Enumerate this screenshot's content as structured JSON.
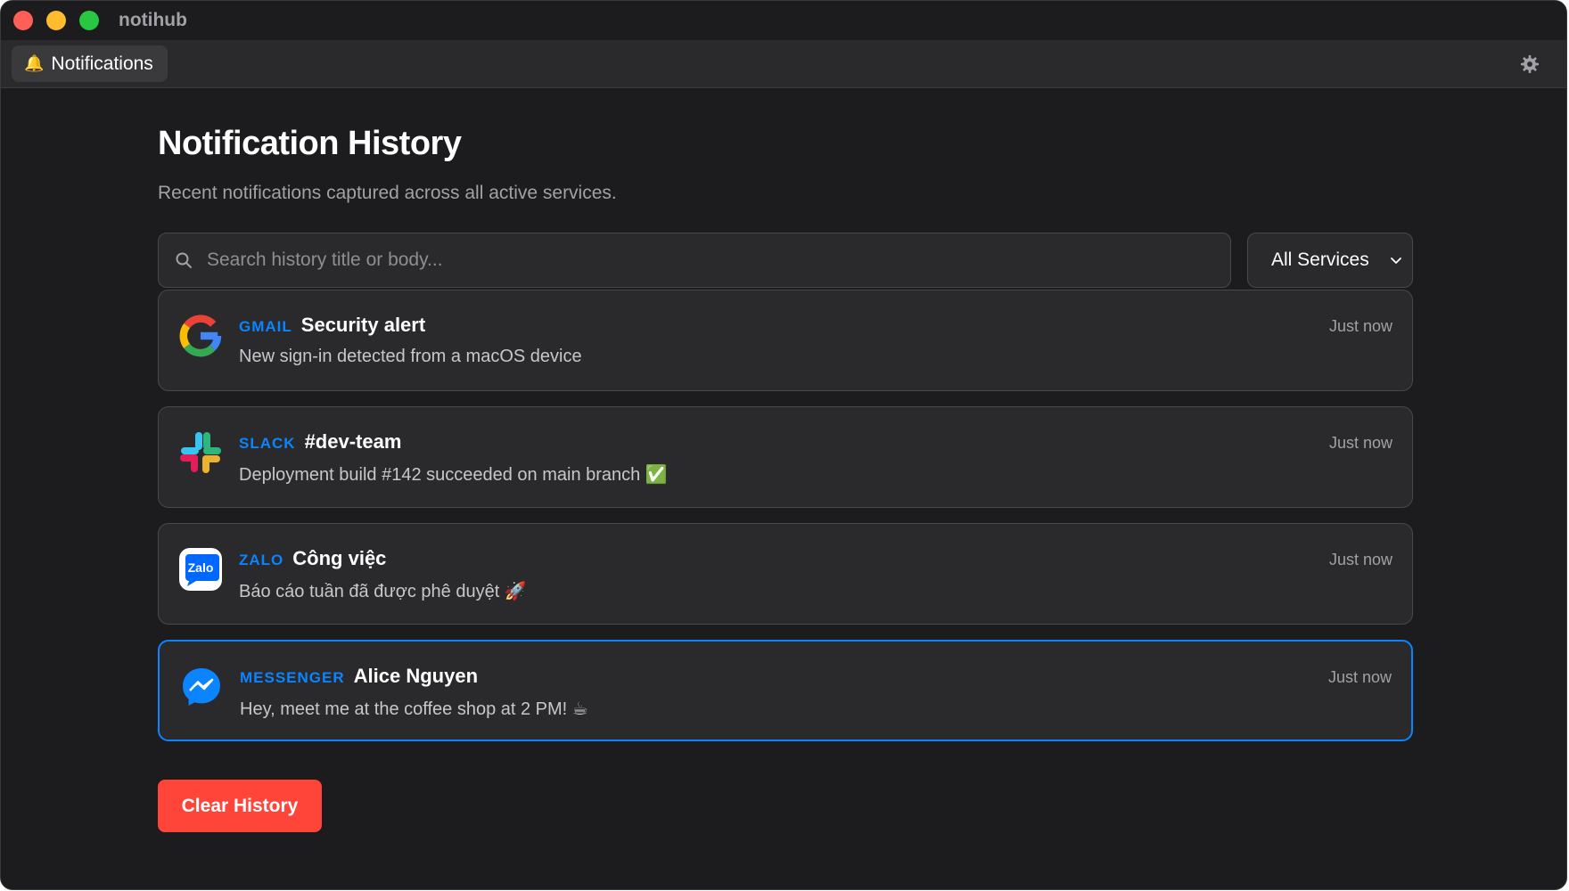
{
  "window": {
    "title": "notihub"
  },
  "toolbar": {
    "tab_icon": "bell-icon",
    "tab_emoji": "🔔",
    "tab_label": "Notifications",
    "settings_icon": "gear-icon"
  },
  "header": {
    "title": "Notification History",
    "subtitle": "Recent notifications captured across all active services."
  },
  "filters": {
    "search_placeholder": "Search history title or body...",
    "search_value": "",
    "service_selected": "All Services"
  },
  "notifications": [
    {
      "service": "GMAIL",
      "icon": "google-icon",
      "title": "Security alert",
      "body": "New sign-in detected from a macOS device",
      "time": "Just now",
      "selected": false
    },
    {
      "service": "SLACK",
      "icon": "slack-icon",
      "title": "#dev-team",
      "body": "Deployment build #142 succeeded on main branch ✅",
      "time": "Just now",
      "selected": false
    },
    {
      "service": "ZALO",
      "icon": "zalo-icon",
      "title": "Công việc",
      "body": "Báo cáo tuần đã được phê duyệt 🚀",
      "time": "Just now",
      "selected": false
    },
    {
      "service": "MESSENGER",
      "icon": "messenger-icon",
      "title": "Alice Nguyen",
      "body": "Hey, meet me at the coffee shop at 2 PM! ☕",
      "time": "Just now",
      "selected": true
    }
  ],
  "actions": {
    "clear_label": "Clear History"
  },
  "colors": {
    "accent": "#0a84ff",
    "danger": "#ff453a",
    "background": "#1c1c1e",
    "card": "#2a2a2c"
  }
}
